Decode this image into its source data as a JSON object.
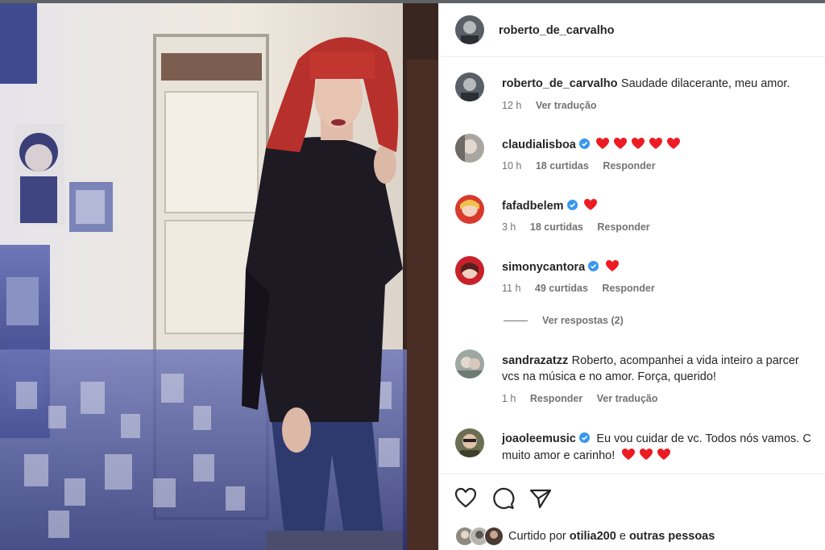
{
  "post": {
    "author": "roberto_de_carvalho",
    "caption": {
      "username": "roberto_de_carvalho",
      "text": "Saudade dilacerante, meu amor.",
      "time": "12 h",
      "translate": "Ver tradução"
    }
  },
  "comments": [
    {
      "username": "claudialisboa",
      "verified": true,
      "text": "",
      "hearts": 5,
      "time": "10 h",
      "likes": "18 curtidas",
      "reply": "Responder"
    },
    {
      "username": "fafadbelem",
      "verified": true,
      "text": "",
      "hearts": 1,
      "time": "3 h",
      "likes": "18 curtidas",
      "reply": "Responder"
    },
    {
      "username": "simonycantora",
      "verified": true,
      "text": "",
      "hearts": 1,
      "time": "11 h",
      "likes": "49 curtidas",
      "reply": "Responder"
    },
    {
      "username": "sandrazatzz",
      "verified": false,
      "line1": "Roberto, acompanhei a vida inteiro a parcer",
      "line2": "vcs na música e no amor. Força, querido!",
      "time": "1 h",
      "reply": "Responder",
      "translate": "Ver tradução"
    },
    {
      "username": "joaoleemusic",
      "verified": true,
      "line1": "Eu vou cuidar de vc. Todos nós vamos. C",
      "line2": "muito amor e carinho!",
      "hearts": 3
    }
  ],
  "view_replies": "Ver respostas (2)",
  "likes_bar": {
    "prefix": "Curtido por",
    "user": "otilia200",
    "connector": "e",
    "rest": "outras pessoas"
  },
  "icons": [
    "heart-outline-icon",
    "comment-icon",
    "share-icon",
    "verified-badge-icon",
    "red-heart-icon"
  ],
  "colors": {
    "verified": "#3897f0",
    "heart": "#ed1c24",
    "muted": "#737373",
    "text": "#262626"
  }
}
